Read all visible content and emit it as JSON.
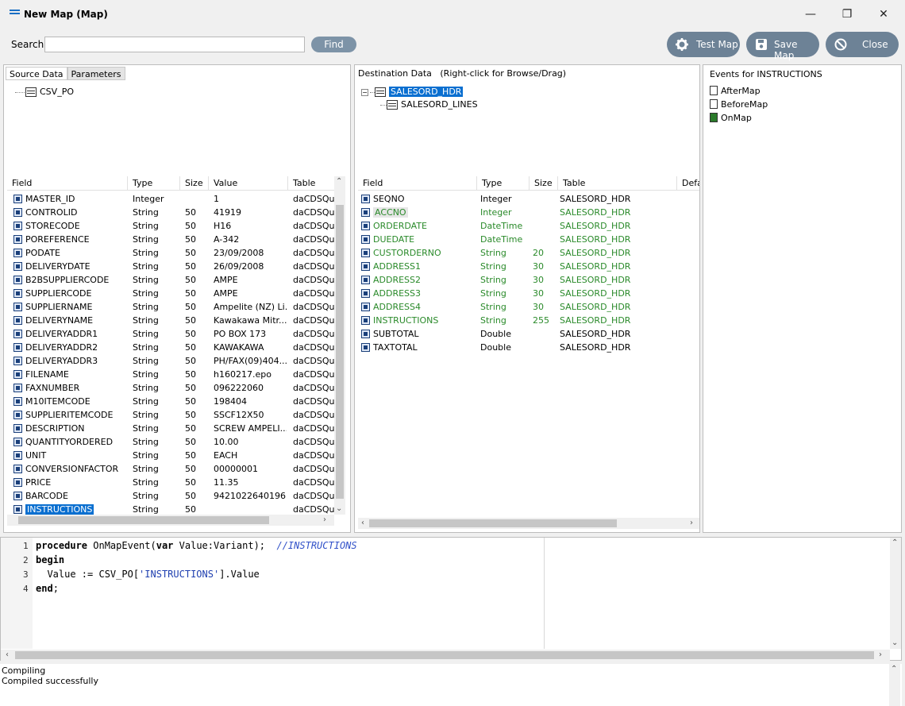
{
  "window": {
    "title": "New Map (Map)"
  },
  "search": {
    "label": "Search",
    "placeholder": "",
    "value": "",
    "find_label": "Find"
  },
  "toolbar": {
    "test_map": "Test Map",
    "save_map": "Save Map",
    "close": "Close"
  },
  "source": {
    "tabs": [
      "Source Data",
      "Parameters"
    ],
    "tree": [
      {
        "label": "CSV_PO"
      }
    ],
    "columns": [
      "Field",
      "Type",
      "Size",
      "Value",
      "Table"
    ],
    "rows": [
      [
        "MASTER_ID",
        "Integer",
        "",
        "1",
        "daCDSQue"
      ],
      [
        "CONTROLID",
        "String",
        "50",
        "41919",
        "daCDSQue"
      ],
      [
        "STORECODE",
        "String",
        "50",
        "H16",
        "daCDSQue"
      ],
      [
        "POREFERENCE",
        "String",
        "50",
        "A-342",
        "daCDSQue"
      ],
      [
        "PODATE",
        "String",
        "50",
        "23/09/2008",
        "daCDSQue"
      ],
      [
        "DELIVERYDATE",
        "String",
        "50",
        "26/09/2008",
        "daCDSQue"
      ],
      [
        "B2BSUPPLIERCODE",
        "String",
        "50",
        "AMPE",
        "daCDSQue"
      ],
      [
        "SUPPLIERCODE",
        "String",
        "50",
        "AMPE",
        "daCDSQue"
      ],
      [
        "SUPPLIERNAME",
        "String",
        "50",
        "Ampelite (NZ) Li...",
        "daCDSQue"
      ],
      [
        "DELIVERYNAME",
        "String",
        "50",
        "Kawakawa Mitr...",
        "daCDSQue"
      ],
      [
        "DELIVERYADDR1",
        "String",
        "50",
        "PO BOX 173",
        "daCDSQue"
      ],
      [
        "DELIVERYADDR2",
        "String",
        "50",
        "KAWAKAWA",
        "daCDSQue"
      ],
      [
        "DELIVERYADDR3",
        "String",
        "50",
        "PH/FAX(09)404...",
        "daCDSQue"
      ],
      [
        "FILENAME",
        "String",
        "50",
        "h160217.epo",
        "daCDSQue"
      ],
      [
        "FAXNUMBER",
        "String",
        "50",
        "096222060",
        "daCDSQue"
      ],
      [
        "M10ITEMCODE",
        "String",
        "50",
        "198404",
        "daCDSQue"
      ],
      [
        "SUPPLIERITEMCODE",
        "String",
        "50",
        "SSCF12X50",
        "daCDSQue"
      ],
      [
        "DESCRIPTION",
        "String",
        "50",
        "SCREW AMPELI...",
        "daCDSQue"
      ],
      [
        "QUANTITYORDERED",
        "String",
        "50",
        "10.00",
        "daCDSQue"
      ],
      [
        "UNIT",
        "String",
        "50",
        "EACH",
        "daCDSQue"
      ],
      [
        "CONVERSIONFACTOR",
        "String",
        "50",
        "00000001",
        "daCDSQue"
      ],
      [
        "PRICE",
        "String",
        "50",
        "11.35",
        "daCDSQue"
      ],
      [
        "BARCODE",
        "String",
        "50",
        "9421022640196",
        "daCDSQue"
      ],
      [
        "INSTRUCTIONS",
        "String",
        "50",
        "",
        "daCDSQue."
      ]
    ]
  },
  "destination": {
    "header": "Destination Data",
    "hint": "(Right-click for Browse/Drag)",
    "tree": [
      {
        "label": "SALESORD_HDR"
      },
      {
        "label": "SALESORD_LINES"
      }
    ],
    "columns": [
      "Field",
      "Type",
      "Size",
      "Table",
      "Defau"
    ],
    "rows": [
      [
        "SEQNO",
        "Integer",
        "",
        "SALESORD_HDR",
        "black"
      ],
      [
        "ACCNO",
        "Integer",
        "",
        "SALESORD_HDR",
        "green"
      ],
      [
        "ORDERDATE",
        "DateTime",
        "",
        "SALESORD_HDR",
        "green"
      ],
      [
        "DUEDATE",
        "DateTime",
        "",
        "SALESORD_HDR",
        "green"
      ],
      [
        "CUSTORDERNO",
        "String",
        "20",
        "SALESORD_HDR",
        "green"
      ],
      [
        "ADDRESS1",
        "String",
        "30",
        "SALESORD_HDR",
        "green"
      ],
      [
        "ADDRESS2",
        "String",
        "30",
        "SALESORD_HDR",
        "green"
      ],
      [
        "ADDRESS3",
        "String",
        "30",
        "SALESORD_HDR",
        "green"
      ],
      [
        "ADDRESS4",
        "String",
        "30",
        "SALESORD_HDR",
        "green"
      ],
      [
        "INSTRUCTIONS",
        "String",
        "255",
        "SALESORD_HDR",
        "green"
      ],
      [
        "SUBTOTAL",
        "Double",
        "",
        "SALESORD_HDR",
        "black"
      ],
      [
        "TAXTOTAL",
        "Double",
        "",
        "SALESORD_HDR",
        "black"
      ]
    ]
  },
  "events": {
    "header": "Events for INSTRUCTIONS",
    "items": [
      "AfterMap",
      "BeforeMap",
      "OnMap"
    ]
  },
  "code": {
    "line_numbers": [
      "1",
      "2",
      "3",
      "4"
    ],
    "lines": [
      {
        "kw1": "procedure",
        "t1": " OnMapEvent(",
        "kw2": "var",
        "t2": " Value:Variant);  ",
        "comment": "//INSTRUCTIONS"
      },
      {
        "kw1": "begin"
      },
      {
        "t1": "  Value := CSV_PO[",
        "str": "'INSTRUCTIONS'",
        "t2": "].Value"
      },
      {
        "kw1": "end",
        "t1": ";"
      }
    ]
  },
  "status": [
    "Compiling",
    "Compiled successfully"
  ],
  "colors": {
    "accent": "#0a6fd0",
    "button": "#6d8296",
    "green_field": "#2a8a2a"
  }
}
